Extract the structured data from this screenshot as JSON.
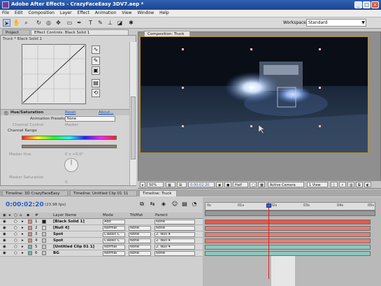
{
  "window": {
    "title": "Adobe After Effects - CrazyFaceEasy 3DV7.aep *"
  },
  "menu": [
    "File",
    "Edit",
    "Composition",
    "Layer",
    "Effect",
    "Animation",
    "View",
    "Window",
    "Help"
  ],
  "toolbar": {
    "workspace_label": "Workspace:",
    "workspace_value": "Standard"
  },
  "left_panel": {
    "tabs": [
      "Project",
      "Effect Controls: Black Solid 1"
    ],
    "breadcrumb": "Truck * Black Solid 1",
    "effect_name": "Hue/Saturation",
    "reset": "Reset",
    "about": "About...",
    "preset_label": "Animation Presets:",
    "preset_value": "None",
    "channel_control_label": "Channel Control",
    "channel_control_value": "Master",
    "channel_range_label": "Channel Range",
    "master_hue_label": "Master Hue",
    "master_hue_value": "0 x +0.0°",
    "master_sat_label": "Master Saturation",
    "master_sat_value": "0"
  },
  "comp": {
    "tab": "Composition: Truck",
    "zoom": "50%",
    "timecode": "0:00:02:20",
    "res": "Half",
    "camera": "Active Camera",
    "views": "1 View"
  },
  "timeline": {
    "tabs": [
      "Timeline: 3D CrazyFaceEasy",
      "Timeline: Untitled Clip 01 11",
      "Timeline: Truck"
    ],
    "timecode": "0:00:02:20",
    "fps": "(23.98 fps)",
    "columns": {
      "layer_name": "Layer Name",
      "mode": "Mode",
      "trkmat": "TrkMat",
      "parent": "Parent"
    },
    "ruler_ticks": [
      "0s",
      "01s",
      "02s",
      "03s",
      "04s",
      "05s"
    ],
    "layers": [
      {
        "num": "1",
        "name": "[Black Solid 1]",
        "mode": "Add",
        "trkmat": "",
        "parent": "None",
        "color": "#1a1a1a"
      },
      {
        "num": "2",
        "name": "[Null 4]",
        "mode": "Normal",
        "trkmat": "None",
        "parent": "None",
        "color": "#d96a6a"
      },
      {
        "num": "3",
        "name": "Spot",
        "mode": "Classic C",
        "trkmat": "None",
        "parent": "2. Null 4",
        "color": "#d96a6a"
      },
      {
        "num": "4",
        "name": "Spot",
        "mode": "Classic C",
        "trkmat": "None",
        "parent": "2. Null 4",
        "color": "#d96a6a"
      },
      {
        "num": "5",
        "name": "[Untitled Clip 01 1]",
        "mode": "Normal",
        "trkmat": "None",
        "parent": "2. Null 4",
        "color": "#6fb8ad"
      },
      {
        "num": "6",
        "name": "BG",
        "mode": "Normal",
        "trkmat": "None",
        "parent": "None",
        "color": "#6fb8ad"
      }
    ]
  }
}
